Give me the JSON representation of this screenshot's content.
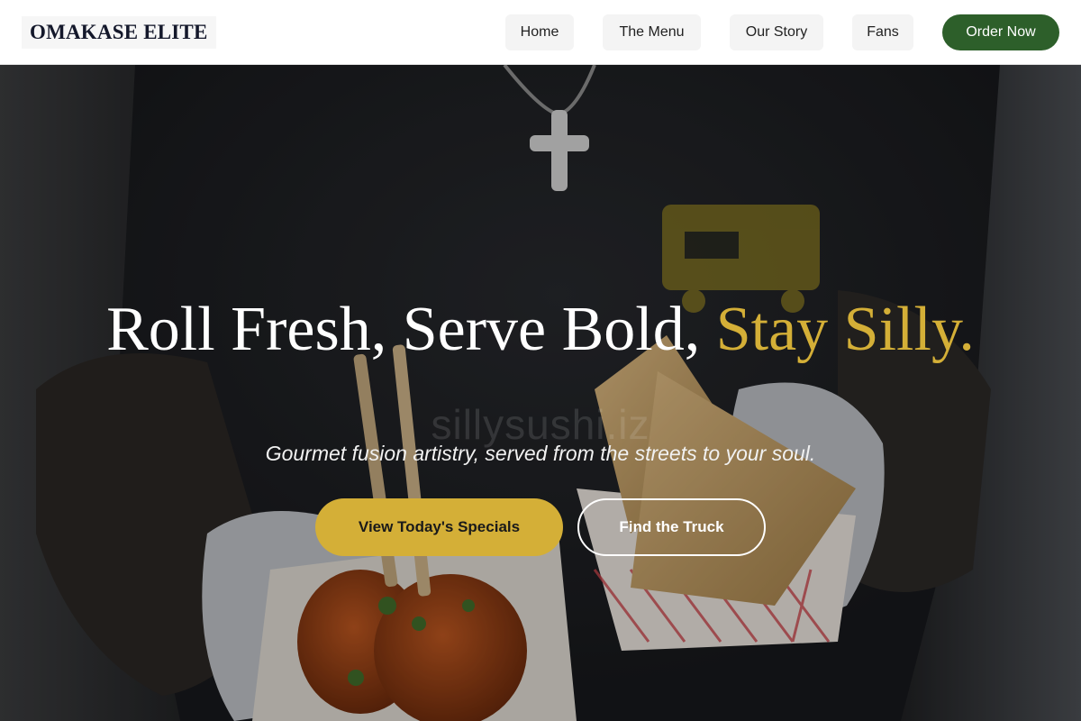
{
  "header": {
    "brand": "OMAKASE ELITE",
    "nav": [
      {
        "label": "Home"
      },
      {
        "label": "The Menu"
      },
      {
        "label": "Our Story"
      },
      {
        "label": "Fans"
      }
    ],
    "cta": "Order Now"
  },
  "hero": {
    "headline_main": "Roll Fresh, Serve Bold,",
    "headline_accent": "Stay Silly.",
    "watermark": "sillysushi.iz",
    "subtitle": "Gourmet fusion artistry, served from the streets to your soul.",
    "primary_button": "View Today's Specials",
    "secondary_button": "Find the Truck"
  },
  "colors": {
    "brand_green": "#2d5f2a",
    "accent_gold": "#d4af37",
    "header_bg": "#ffffff"
  }
}
